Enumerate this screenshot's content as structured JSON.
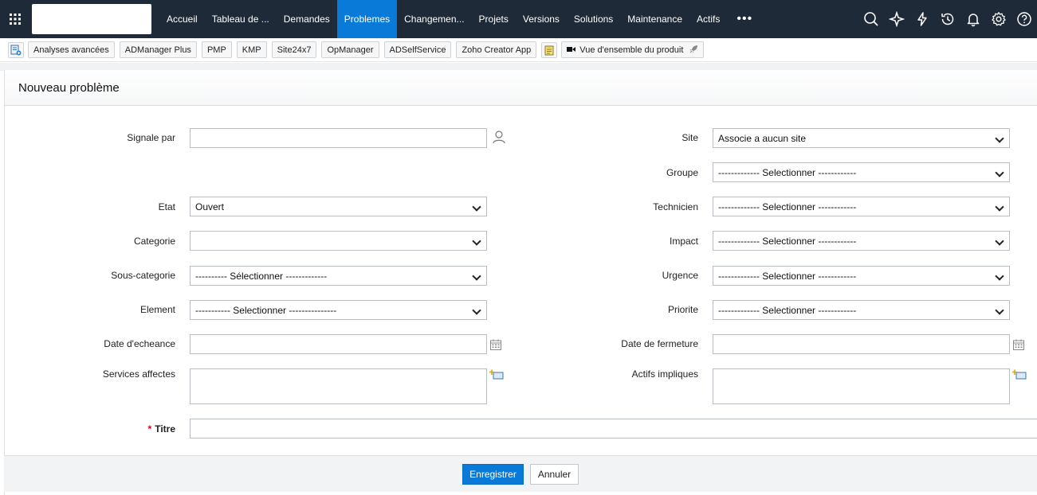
{
  "nav": {
    "items": [
      {
        "label": "Accueil",
        "active": false
      },
      {
        "label": "Tableau de ...",
        "active": false
      },
      {
        "label": "Demandes",
        "active": false
      },
      {
        "label": "Problemes",
        "active": true
      },
      {
        "label": "Changemen...",
        "active": false
      },
      {
        "label": "Projets",
        "active": false
      },
      {
        "label": "Versions",
        "active": false
      },
      {
        "label": "Solutions",
        "active": false
      },
      {
        "label": "Maintenance",
        "active": false
      },
      {
        "label": "Actifs",
        "active": false
      }
    ],
    "more": "•••",
    "icons": [
      "search-icon",
      "quick-action-icon",
      "lightning-icon",
      "history-icon",
      "bell-icon",
      "gear-icon",
      "help-icon"
    ],
    "active_color": "#0a7ad8",
    "bg_color": "#1e2a38"
  },
  "toolbar": {
    "buttons": [
      "Analyses avancées",
      "ADManager Plus",
      "PMP",
      "KMP",
      "Site24x7",
      "OpManager",
      "ADSelfService",
      "Zoho Creator App"
    ],
    "overview": "Vue d'ensemble du produit"
  },
  "form": {
    "title": "Nouveau problème",
    "left": {
      "signale_par": {
        "label": "Signale par",
        "value": ""
      },
      "etat": {
        "label": "Etat",
        "value": "Ouvert"
      },
      "categorie": {
        "label": "Categorie",
        "value": ""
      },
      "sous_categorie": {
        "label": "Sous-categorie",
        "value": "---------- Sélectionner -------------"
      },
      "element": {
        "label": "Element",
        "value": "----------- Selectionner ---------------"
      },
      "date_echeance": {
        "label": "Date d'echeance",
        "value": ""
      },
      "services_affectes": {
        "label": "Services affectes",
        "value": ""
      }
    },
    "right": {
      "site": {
        "label": "Site",
        "value": "Associe a aucun site"
      },
      "groupe": {
        "label": "Groupe",
        "value": "------------- Selectionner ------------"
      },
      "technicien": {
        "label": "Technicien",
        "value": "------------- Selectionner ------------"
      },
      "impact": {
        "label": "Impact",
        "value": "------------- Selectionner ------------"
      },
      "urgence": {
        "label": "Urgence",
        "value": "------------- Selectionner ------------"
      },
      "priorite": {
        "label": "Priorite",
        "value": "------------- Selectionner ------------"
      },
      "date_fermeture": {
        "label": "Date de fermeture",
        "value": ""
      },
      "actifs_impliques": {
        "label": "Actifs impliques",
        "value": ""
      }
    },
    "titre": {
      "required_mark": "*",
      "label": "Titre",
      "value": ""
    }
  },
  "footer": {
    "save": "Enregistrer",
    "cancel": "Annuler"
  }
}
